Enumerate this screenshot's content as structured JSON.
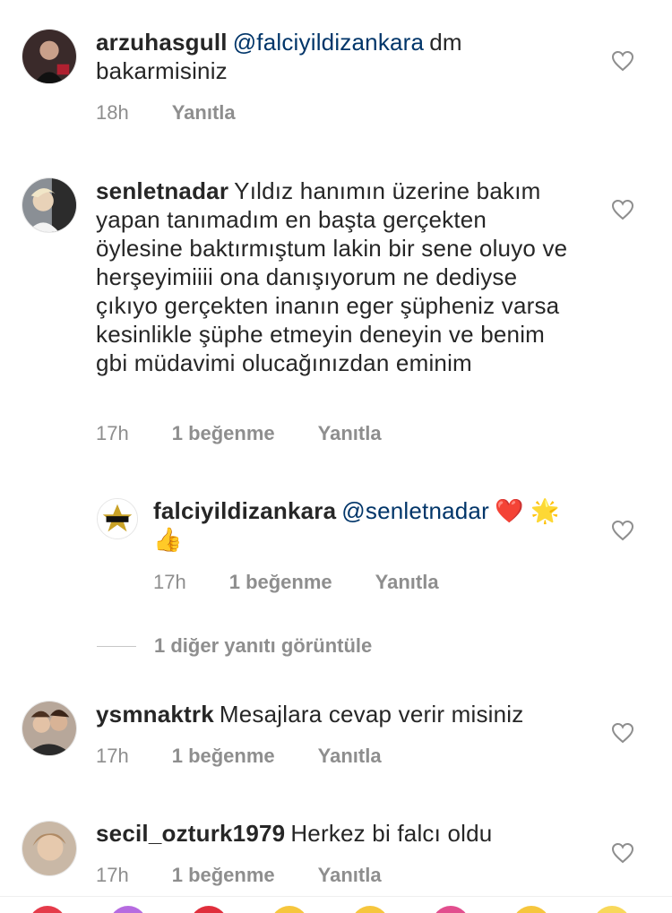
{
  "comments": [
    {
      "username": "arzuhasgull",
      "mention": "@falciyildizankara",
      "text": "dm bakarmisiniz",
      "time": "18h",
      "likes": "",
      "reply": "Yanıtla"
    },
    {
      "username": "senletnadar",
      "mention": "",
      "text": "Yıldız hanımın üzerine bakım yapan tanımadım en başta gerçekten öylesine baktırmıştum lakin bir sene oluyo ve herşeyimiiii ona danışıyorum ne dediyse çıkıyo gerçekten inanın eger şüpheniz varsa kesinlikle şüphe etmeyin deneyin ve benim gbi müdavimi olucağınızdan eminim",
      "time": "17h",
      "likes": "1 beğenme",
      "reply": "Yanıtla"
    },
    {
      "username": "falciyildizankara",
      "mention": "@senletnadar",
      "text": "❤️ 🌟 👍",
      "time": "17h",
      "likes": "1 beğenme",
      "reply": "Yanıtla"
    },
    {
      "username": "ysmnaktrk",
      "mention": "",
      "text": "Mesajlara cevap verir misiniz",
      "time": "17h",
      "likes": "1 beğenme",
      "reply": "Yanıtla"
    },
    {
      "username": "secil_ozturk1979",
      "mention": "",
      "text": "Herkez bi falcı oldu",
      "time": "17h",
      "likes": "1 beğenme",
      "reply": "Yanıtla"
    }
  ],
  "view_replies": "1 diğer yanıtı görüntüle",
  "icons": {
    "like": "heart-outline-icon"
  },
  "colors": {
    "text": "#262626",
    "meta": "#8e8e8e",
    "mention": "#003569"
  }
}
